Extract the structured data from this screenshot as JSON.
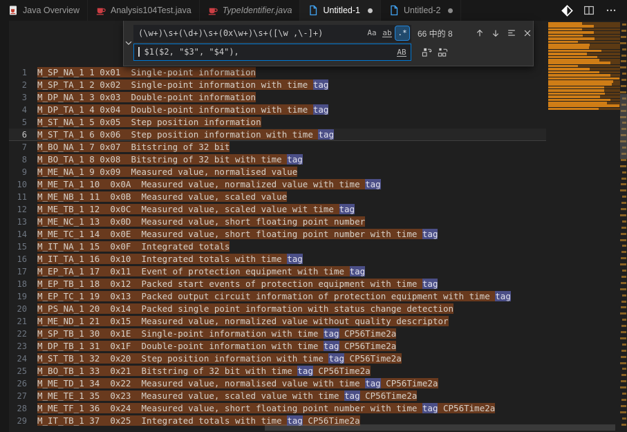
{
  "tabs": [
    {
      "label": "Java Overview",
      "icon": "java-overview-icon",
      "active": false,
      "modified": false,
      "italic": false
    },
    {
      "label": "Analysis104Test.java",
      "icon": "java-file-icon",
      "active": false,
      "modified": false,
      "italic": false
    },
    {
      "label": "TypeIdentifier.java",
      "icon": "java-file-icon",
      "active": false,
      "modified": false,
      "italic": true
    },
    {
      "label": "Untitled-1",
      "icon": "untitled-file-icon",
      "active": true,
      "modified": true,
      "italic": false
    },
    {
      "label": "Untitled-2",
      "icon": "untitled-file-icon",
      "active": false,
      "modified": true,
      "italic": false
    }
  ],
  "find": {
    "search_value": "(\\w+)\\s+(\\d+)\\s+(0x\\w+)\\s+([\\w ,\\-]+)",
    "match_case_label": "Aa",
    "whole_word_label": "ab",
    "regex_label": ".*",
    "results_label": "66 中的 8",
    "replace_value": "$1($2, \"$3\", \"$4\"),",
    "preserve_case_label": "AB"
  },
  "editor": {
    "current_line": 6,
    "selected_word": "tag",
    "total_matches": 66,
    "lines": [
      {
        "n": 1,
        "text": "M_SP_NA_1 1 0x01  Single-point information"
      },
      {
        "n": 2,
        "text": "M_SP_TA_1 2 0x02  Single-point information with time tag"
      },
      {
        "n": 3,
        "text": "M_DP_NA_1 3 0x03  Double-point information"
      },
      {
        "n": 4,
        "text": "M_DP_TA_1 4 0x04  Double-point information with time tag"
      },
      {
        "n": 5,
        "text": "M_ST_NA_1 5 0x05  Step position information"
      },
      {
        "n": 6,
        "text": "M_ST_TA_1 6 0x06  Step position information with time tag"
      },
      {
        "n": 7,
        "text": "M_BO_NA_1 7 0x07  Bitstring of 32 bit"
      },
      {
        "n": 8,
        "text": "M_BO_TA_1 8 0x08  Bitstring of 32 bit with time tag"
      },
      {
        "n": 9,
        "text": "M_ME_NA_1 9 0x09  Measured value, normalised value"
      },
      {
        "n": 10,
        "text": "M_ME_TA_1 10  0x0A  Measured value, normalized value with time tag"
      },
      {
        "n": 11,
        "text": "M_ME_NB_1 11  0x0B  Measured value, scaled value"
      },
      {
        "n": 12,
        "text": "M_ME_TB_1 12  0x0C  Measured value, scaled value wit time tag"
      },
      {
        "n": 13,
        "text": "M_ME_NC_1 13  0x0D  Measured value, short floating point number"
      },
      {
        "n": 14,
        "text": "M_ME_TC_1 14  0x0E  Measured value, short floating point number with time tag"
      },
      {
        "n": 15,
        "text": "M_IT_NA_1 15  0x0F  Integrated totals"
      },
      {
        "n": 16,
        "text": "M_IT_TA_1 16  0x10  Integrated totals with time tag"
      },
      {
        "n": 17,
        "text": "M_EP_TA_1 17  0x11  Event of protection equipment with time tag"
      },
      {
        "n": 18,
        "text": "M_EP_TB_1 18  0x12  Packed start events of protection equipment with time tag"
      },
      {
        "n": 19,
        "text": "M_EP_TC_1 19  0x13  Packed output circuit information of protection equipment with time tag"
      },
      {
        "n": 20,
        "text": "M_PS_NA_1 20  0x14  Packed single point information with status change detection"
      },
      {
        "n": 21,
        "text": "M_ME_ND_1 21  0x15  Measured value, normalized value without quality descriptor"
      },
      {
        "n": 22,
        "text": "M_SP_TB_1 30  0x1E  Single-point information with time tag CP56Time2a"
      },
      {
        "n": 23,
        "text": "M_DP_TB_1 31  0x1F  Double-point information with time tag CP56Time2a"
      },
      {
        "n": 24,
        "text": "M_ST_TB_1 32  0x20  Step position information with time tag CP56Time2a"
      },
      {
        "n": 25,
        "text": "M_BO_TB_1 33  0x21  Bitstring of 32 bit with time tag CP56Time2a"
      },
      {
        "n": 26,
        "text": "M_ME_TD_1 34  0x22  Measured value, normalised value with time tag CP56Time2a"
      },
      {
        "n": 27,
        "text": "M_ME_TE_1 35  0x23  Measured value, scaled value with time tag CP56Time2a"
      },
      {
        "n": 28,
        "text": "M_ME_TF_1 36  0x24  Measured value, short floating point number with time tag CP56Time2a"
      },
      {
        "n": 29,
        "text": "M_IT_TB_1 37  0x25  Integrated totals with time tag CP56Time2a"
      }
    ]
  },
  "colors": {
    "match_highlight": "#693a1e",
    "selection_highlight": "#4b4f87",
    "minimap_match": "#cf7d16",
    "minimap_text": "#5c3a14",
    "accent": "#0078d4"
  }
}
